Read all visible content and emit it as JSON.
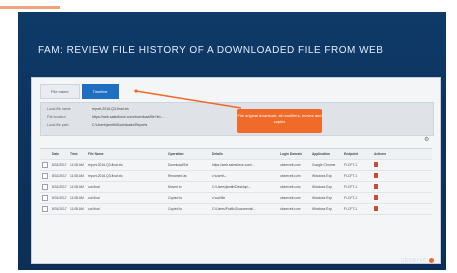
{
  "slide": {
    "headline": "FAM: REVIEW FILE HISTORY OF A DOWNLOADED FILE FROM WEB",
    "logo_text": "observe"
  },
  "tabs": [
    {
      "label": "File name"
    },
    {
      "label": "Timeline"
    }
  ],
  "info": [
    {
      "label": "Local file name",
      "value": "report-2016-Q3-final.xls"
    },
    {
      "label": "File location",
      "value": "https://web.salesforce.com/download/file?id=..."
    },
    {
      "label": "Local file path",
      "value": "C:\\Users\\jsmith\\Downloads\\Reports"
    }
  ],
  "callout": {
    "text": "File original download, all modifiers, moves and copies"
  },
  "table": {
    "headers": [
      "",
      "Date",
      "Time",
      "File Name",
      "Operation",
      "Details",
      "Login Domain",
      "Application",
      "Endpoint",
      "Actions"
    ],
    "rows": [
      [
        "8/31/2017",
        "11:08 AM",
        "report-2016-Q3-final.xls",
        "Download/Ext",
        "https://web.salesforce.com/...",
        "observeit.com",
        "Google Chrome",
        "FI-CFT-1"
      ],
      [
        "8/31/2017",
        "11:08 AM",
        "report-2016-Q3-final.xls",
        "Renamed as",
        "c:\\users\\...",
        "observeit.com",
        "Windows Exp",
        "FI-CFT-1"
      ],
      [
        "8/31/2017",
        "11:08 AM",
        "out.final",
        "Moved to",
        "C:\\Users\\jsmith\\Desktop\\...",
        "observeit.com",
        "Windows Exp",
        "FI-CFT-1"
      ],
      [
        "8/31/2017",
        "11:08 AM",
        "out.final",
        "Copied to",
        "c:\\out\\file",
        "observeit.com",
        "Windows Exp",
        "FI-CFT-1"
      ],
      [
        "8/31/2017",
        "11:08 AM",
        "out.final",
        "Copied to",
        "C:\\Users\\Public\\Documents\\...",
        "observeit.com",
        "Windows Exp",
        "FI-CFT-1"
      ]
    ]
  },
  "icons": {
    "settings": "gear-icon",
    "delete": "trash-icon",
    "file": "file-icon"
  },
  "colors": {
    "slide_bg": "#0d3460",
    "accent": "#f06a2a",
    "tab_active": "#1f6fc0"
  }
}
